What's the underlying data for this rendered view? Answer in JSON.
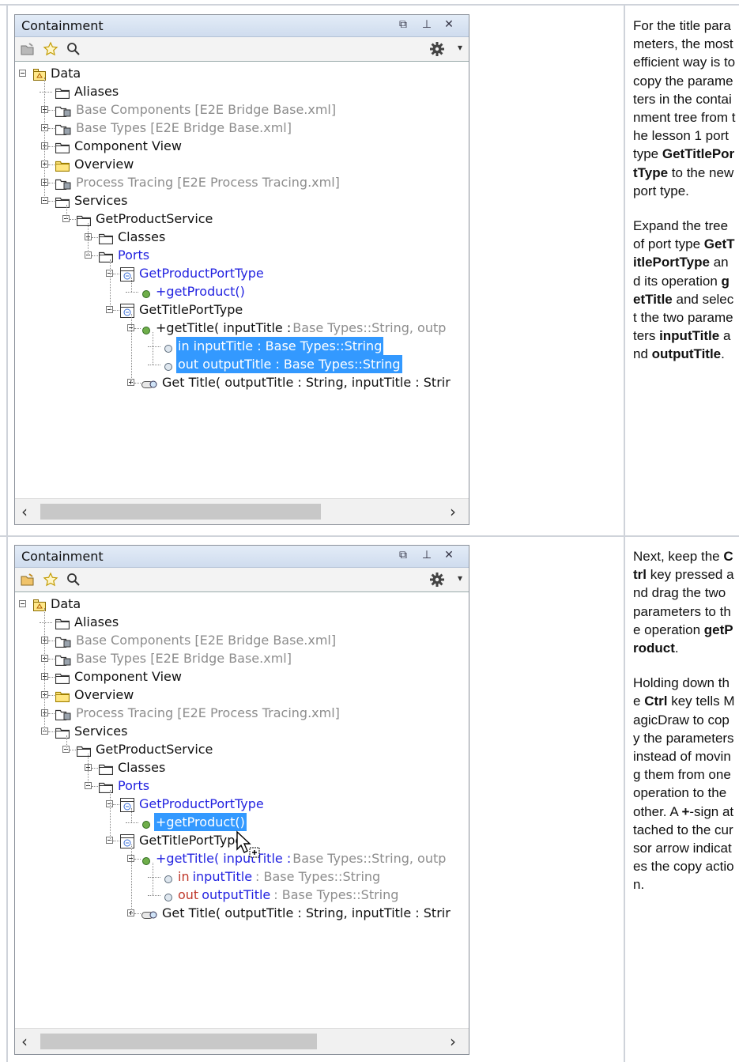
{
  "panels": [
    {
      "title": "Containment",
      "tree": [
        {
          "label": "Data",
          "style": "normal",
          "icon": "package-icon"
        },
        {
          "label": "Aliases",
          "style": "normal",
          "icon": "folder-icon"
        },
        {
          "label": "Base Components [E2E Bridge Base.xml]",
          "style": "gray",
          "icon": "shared-package-icon"
        },
        {
          "label": "Base Types [E2E Bridge Base.xml]",
          "style": "gray",
          "icon": "shared-package-icon"
        },
        {
          "label": "Component View",
          "style": "normal",
          "icon": "folder-icon"
        },
        {
          "label": "Overview",
          "style": "normal",
          "icon": "yellow-folder-icon"
        },
        {
          "label": "Process Tracing [E2E Process Tracing.xml]",
          "style": "gray",
          "icon": "shared-package-icon"
        },
        {
          "label": "Services",
          "style": "normal",
          "icon": "folder-icon"
        },
        {
          "label": "GetProductService",
          "style": "normal",
          "icon": "folder-icon"
        },
        {
          "label": "Classes",
          "style": "normal",
          "icon": "folder-icon"
        },
        {
          "label": "Ports",
          "style": "blue",
          "icon": "folder-icon"
        },
        {
          "label": "GetProductPortType",
          "style": "blue",
          "icon": "interface-icon"
        },
        {
          "label": "+getProduct()",
          "style": "blue",
          "icon": "operation-icon"
        },
        {
          "label": "GetTitlePortType",
          "style": "normal",
          "icon": "interface-icon"
        },
        {
          "label": "+getTitle( inputTitle :",
          "suffix": "Base Types::String, outp",
          "style": "normal",
          "icon": "operation-icon"
        },
        {
          "label": "in inputTitle : Base Types::String",
          "style": "selected",
          "icon": "parameter-icon"
        },
        {
          "label": "out outputTitle : Base Types::String",
          "style": "selected",
          "icon": "parameter-icon"
        },
        {
          "label": "Get Title( outputTitle : String, inputTitle : Strir",
          "style": "normal",
          "icon": "activity-icon"
        }
      ]
    },
    {
      "title": "Containment",
      "tree": [
        {
          "label": "Data",
          "style": "normal",
          "icon": "package-icon"
        },
        {
          "label": "Aliases",
          "style": "normal",
          "icon": "folder-icon"
        },
        {
          "label": "Base Components [E2E Bridge Base.xml]",
          "style": "gray",
          "icon": "shared-package-icon"
        },
        {
          "label": "Base Types [E2E Bridge Base.xml]",
          "style": "gray",
          "icon": "shared-package-icon"
        },
        {
          "label": "Component View",
          "style": "normal",
          "icon": "folder-icon"
        },
        {
          "label": "Overview",
          "style": "normal",
          "icon": "yellow-folder-icon"
        },
        {
          "label": "Process Tracing [E2E Process Tracing.xml]",
          "style": "gray",
          "icon": "shared-package-icon"
        },
        {
          "label": "Services",
          "style": "normal",
          "icon": "folder-icon"
        },
        {
          "label": "GetProductService",
          "style": "normal",
          "icon": "folder-icon"
        },
        {
          "label": "Classes",
          "style": "normal",
          "icon": "folder-icon"
        },
        {
          "label": "Ports",
          "style": "blue",
          "icon": "folder-icon"
        },
        {
          "label": "GetProductPortType",
          "style": "blue",
          "icon": "interface-icon"
        },
        {
          "label": "+getProduct()",
          "style": "selected",
          "icon": "operation-icon"
        },
        {
          "label": "GetTitlePortType",
          "style": "normal",
          "icon": "interface-icon"
        },
        {
          "label": "+getTitle( inputTitle :",
          "suffix": "Base Types::String, outp",
          "style": "blue",
          "icon": "operation-icon"
        },
        {
          "label": "in",
          "label2": "inputTitle",
          "suffix": ": Base Types::String",
          "style": "inout",
          "icon": "parameter-icon"
        },
        {
          "label": "out",
          "label2": "outputTitle",
          "suffix": ": Base Types::String",
          "style": "inout",
          "icon": "parameter-icon"
        },
        {
          "label": "Get Title( outputTitle : String, inputTitle : Strir",
          "style": "normal",
          "icon": "activity-icon"
        }
      ]
    }
  ],
  "notes": {
    "n1": {
      "p1": [
        "For the title parameters, the most efficient way is to copy the parameters in the containment tree from the lesson 1 port type ",
        {
          "b": "GetTitlePortType"
        },
        " to the new port type."
      ],
      "p2": [
        "Expand the tree of port type ",
        {
          "b": "GetTitlePortType"
        },
        " and its operation ",
        {
          "b": "getTitle"
        },
        " and select the two parameters ",
        {
          "b": "inputTitle"
        },
        " and ",
        {
          "b": "outputTitle"
        },
        "."
      ]
    },
    "n2": {
      "p1": [
        "Next, keep the ",
        {
          "b": "Ctrl"
        },
        " key pressed and drag the two parameters to the operation ",
        {
          "b": "getProduct"
        },
        "."
      ],
      "p2": [
        "Holding down the ",
        {
          "b": "Ctrl"
        },
        " key tells MagicDraw to copy the parameters instead of moving them from one operation to the other. A ",
        {
          "b": "+"
        },
        "-sign attached to the cursor arrow indicates the copy action."
      ]
    }
  },
  "colors": {
    "selection": "#3399ff",
    "link_blue": "#2323e0",
    "gray_text": "#8d8d8d"
  }
}
